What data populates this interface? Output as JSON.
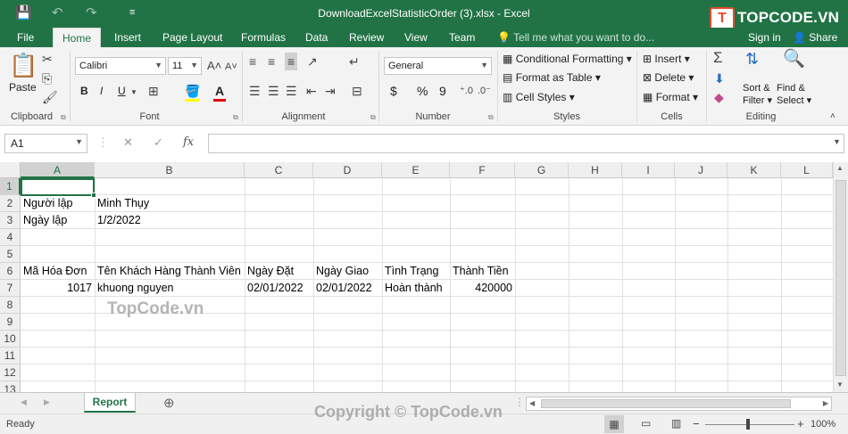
{
  "window": {
    "title": "DownloadExcelStatisticOrder (3).xlsx - Excel",
    "logo_text": "TOPCODE.VN",
    "logo_mark": "T"
  },
  "ribbon_tabs": [
    "File",
    "Home",
    "Insert",
    "Page Layout",
    "Formulas",
    "Data",
    "Review",
    "View",
    "Team"
  ],
  "tell_me": "Tell me what you want to do...",
  "account": {
    "sign_in": "Sign in",
    "share": "Share"
  },
  "ribbon": {
    "clipboard": {
      "paste": "Paste",
      "label": "Clipboard"
    },
    "font": {
      "name": "Calibri",
      "size": "11",
      "bold": "B",
      "italic": "I",
      "underline": "U",
      "label": "Font"
    },
    "alignment": {
      "label": "Alignment"
    },
    "number": {
      "format": "General",
      "currency": "$",
      "percent": "%",
      "comma": "9",
      "label": "Number"
    },
    "styles": {
      "conditional": "Conditional Formatting",
      "format_table": "Format as Table",
      "cell_styles": "Cell Styles",
      "label": "Styles"
    },
    "cells": {
      "insert": "Insert",
      "delete": "Delete",
      "format": "Format",
      "label": "Cells"
    },
    "editing": {
      "sort_line1": "Sort &",
      "sort_line2": "Filter",
      "find_line1": "Find &",
      "find_line2": "Select",
      "label": "Editing"
    }
  },
  "formula_bar": {
    "name_box": "A1",
    "fx": "fx",
    "formula": ""
  },
  "columns": [
    "A",
    "B",
    "C",
    "D",
    "E",
    "F",
    "G",
    "H",
    "I",
    "J",
    "K",
    "L"
  ],
  "rows": [
    "1",
    "2",
    "3",
    "4",
    "5",
    "6",
    "7",
    "8",
    "9",
    "10",
    "11",
    "12",
    "13"
  ],
  "cells": {
    "A2": "Người lập",
    "B2": "Minh Thụy",
    "A3": "Ngày lập",
    "B3": "1/2/2022",
    "A6": "Mã Hóa Đơn",
    "B6": "Tên Khách Hàng Thành Viên",
    "C6": "Ngày Đặt",
    "D6": "Ngày Giao",
    "E6": "Tình Trạng",
    "F6": "Thành Tiền",
    "A7": "1017",
    "B7": "khuong nguyen",
    "C7": "02/01/2022",
    "D7": "02/01/2022",
    "E7": "Hoàn thành",
    "F7": "420000"
  },
  "watermark": {
    "mid": "TopCode.vn",
    "bottom": "Copyright © TopCode.vn"
  },
  "sheet_tabs": [
    "Report"
  ],
  "status": {
    "ready": "Ready",
    "zoom": "100%"
  },
  "colors": {
    "excel_green": "#217346",
    "logo_red": "#e34b2b"
  }
}
